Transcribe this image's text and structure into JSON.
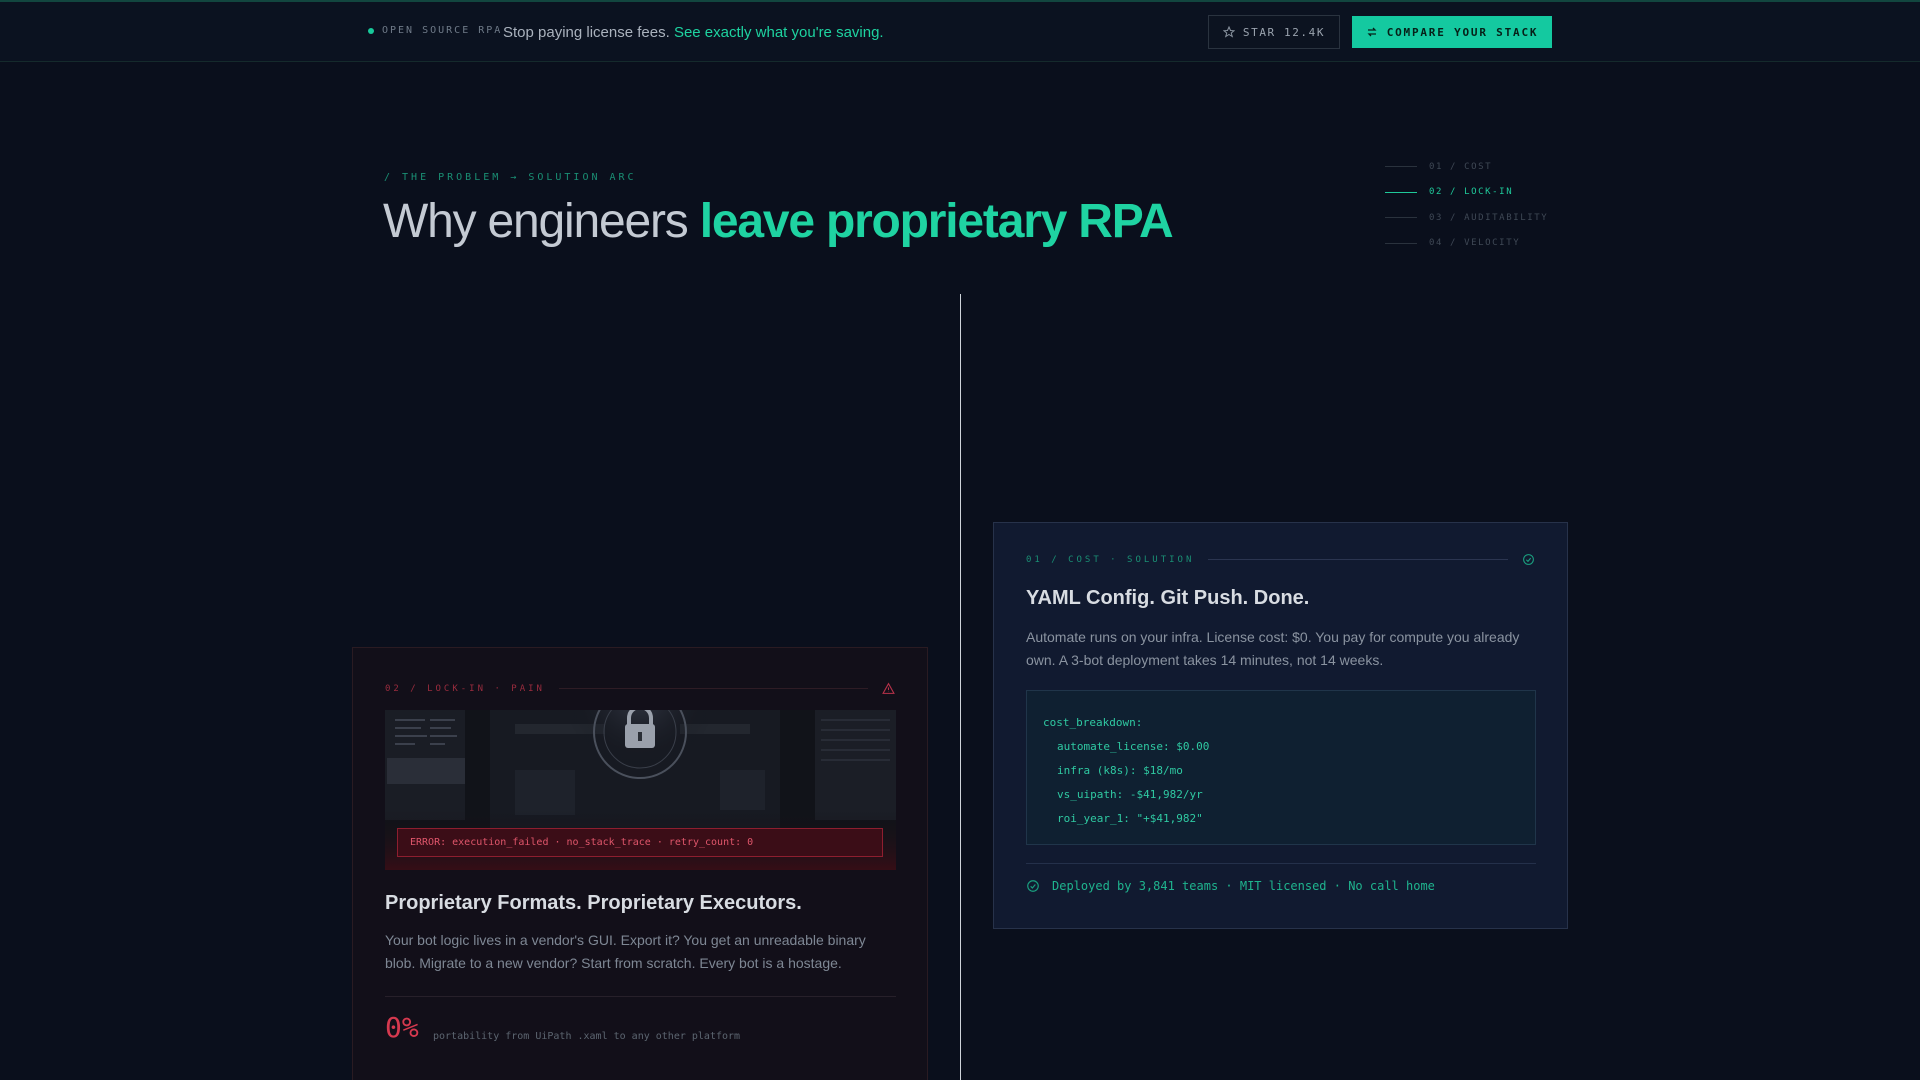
{
  "topbar": {
    "brand": "OPEN SOURCE RPA",
    "tagline": "Stop paying license fees.",
    "tagline_link": "See exactly what you're saving.",
    "star_label": "STAR 12.4K",
    "cta_label": "COMPARE YOUR STACK"
  },
  "hero": {
    "eyebrow": "/ THE PROBLEM → SOLUTION ARC",
    "headline_plain": "Why engineers",
    "headline_accent": "leave proprietary RPA"
  },
  "sidenav": [
    {
      "label": "01 / COST"
    },
    {
      "label": "02 / LOCK-IN"
    },
    {
      "label": "03 / AUDITABILITY"
    },
    {
      "label": "04 / VELOCITY"
    }
  ],
  "pain_card": {
    "label": "02 / LOCK-IN · PAIN",
    "error": "ERROR: execution_failed · no_stack_trace · retry_count: 0",
    "title": "Proprietary Formats. Proprietary Executors.",
    "body": "Your bot logic lives in a vendor's GUI. Export it? You get an unreadable binary blob. Migrate to a new vendor? Start from scratch. Every bot is a hostage.",
    "stat_value": "0%",
    "stat_desc": "portability from UiPath .xaml to any other platform"
  },
  "solution_card": {
    "label": "01 / COST · SOLUTION",
    "title": "YAML Config. Git Push. Done.",
    "body": "Automate runs on your infra. License cost: $0. You pay for compute you already own. A 3-bot deployment takes 14 minutes, not 14 weeks.",
    "code": [
      "cost_breakdown:",
      "automate_license: $0.00",
      "infra (k8s): $18/mo",
      "vs_uipath: -$41,982/yr",
      "roi_year_1: \"+$41,982\""
    ],
    "footer": "Deployed by 3,841 teams · MIT licensed · No call home"
  },
  "colors": {
    "accent": "#1fd3a2",
    "danger": "#d6394f",
    "background": "#0a0f1c"
  },
  "icons": {
    "star": "star-icon",
    "compare": "swap-arrows-icon",
    "warning": "warning-triangle-icon",
    "check": "check-circle-icon",
    "lock": "padlock-icon"
  }
}
